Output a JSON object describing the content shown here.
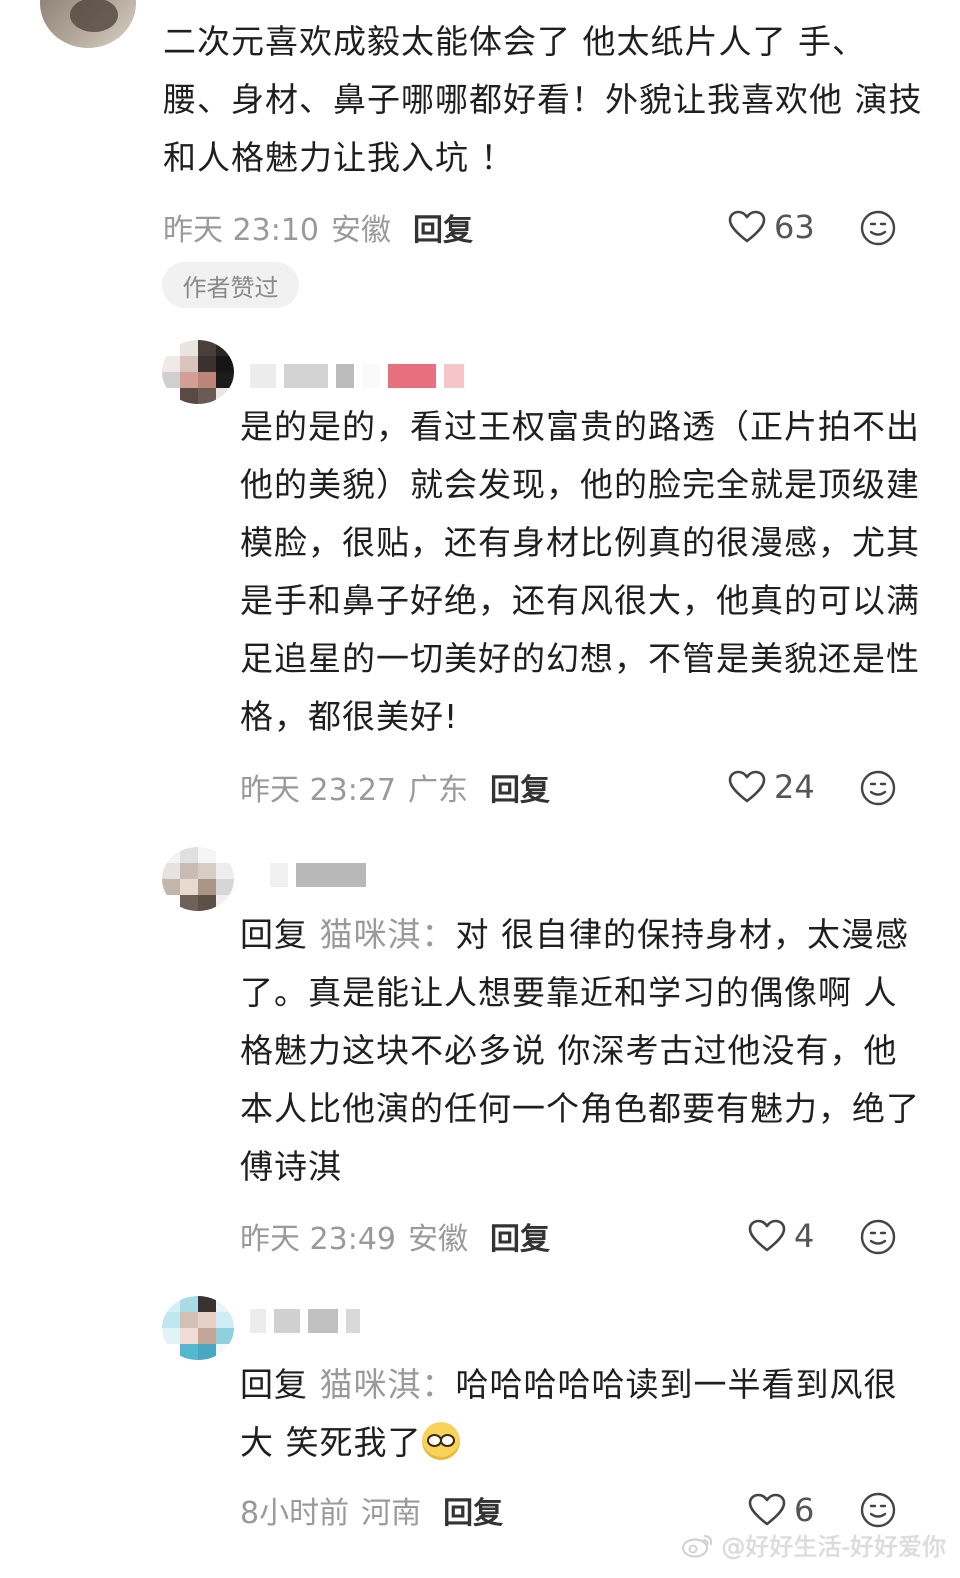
{
  "comments": [
    {
      "text": "二次元喜欢成毅太能体会了 他太纸片人了 手、腰、身材、鼻子哪哪都好看！外貌让我喜欢他 演技和人格魅力让我入坑 ！",
      "time": "昨天 23:10",
      "location": "安徽",
      "reply_label": "回复",
      "likes": "63",
      "badge": "作者赞过"
    },
    {
      "text": "是的是的，看过王权富贵的路透（正片拍不出他的美貌）就会发现，他的脸完全就是顶级建模脸，很贴，还有身材比例真的很漫感，尤其是手和鼻子好绝，还有风很大，他真的可以满足追星的一切美好的幻想，不管是美貌还是性格，都很美好!",
      "time": "昨天 23:27",
      "location": "广东",
      "reply_label": "回复",
      "likes": "24"
    },
    {
      "reply_prefix": "回复",
      "reply_target": "猫咪淇：",
      "text": "对 很自律的保持身材，太漫感了。真是能让人想要靠近和学习的偶像啊 人格魅力这块不必多说 你深考古过他没有，他本人比他演的任何一个角色都要有魅力，绝了傅诗淇",
      "time": "昨天 23:49",
      "location": "安徽",
      "reply_label": "回复",
      "likes": "4"
    },
    {
      "reply_prefix": "回复",
      "reply_target": "猫咪淇：",
      "text": "哈哈哈哈哈读到一半看到风很大 笑死我了",
      "emoji": "glasses-smile-emoji",
      "time": "8小时前",
      "location": "河南",
      "reply_label": "回复",
      "likes": "6"
    }
  ],
  "watermark": "@好好生活-好好爱你",
  "icons": {
    "like": "heart-outline-icon",
    "react": "smile-face-icon",
    "watermark": "weibo-logo-icon"
  },
  "colors": {
    "text": "#1f1f1f",
    "meta": "#9a9a9a",
    "badge_bg": "#f1f1f1"
  }
}
